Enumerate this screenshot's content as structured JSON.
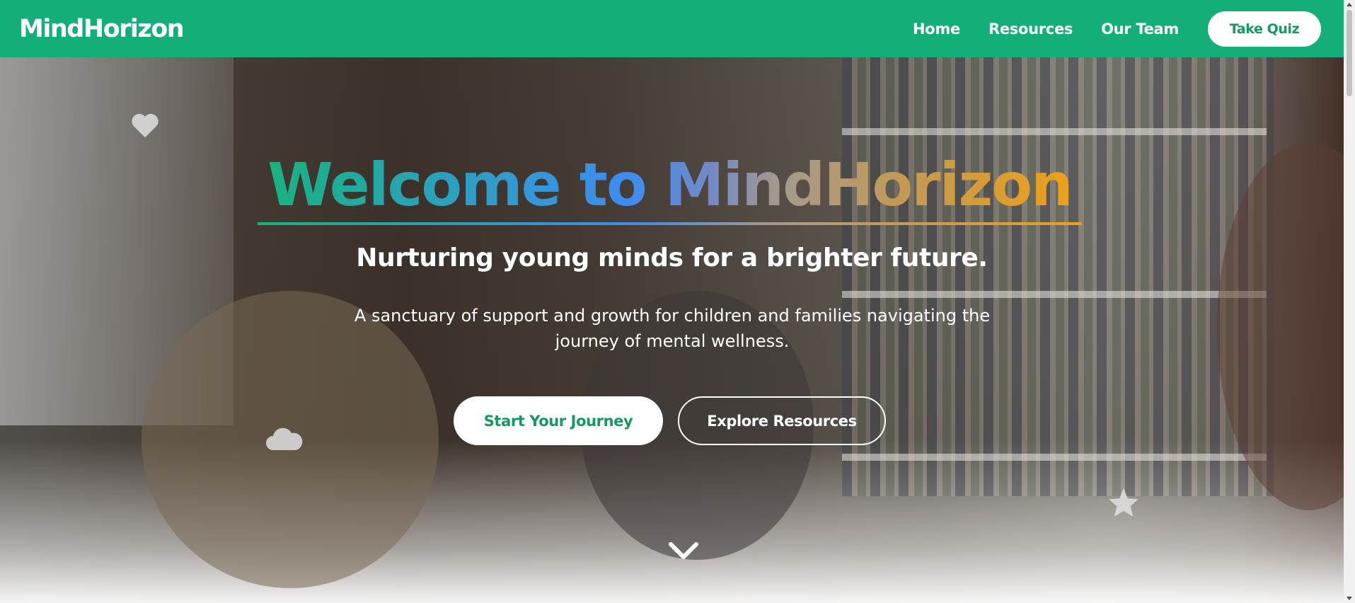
{
  "nav": {
    "logo": "MindHorizon",
    "links": [
      "Home",
      "Resources",
      "Our Team"
    ],
    "cta": "Take Quiz"
  },
  "hero": {
    "title": "Welcome to MindHorizon",
    "subtitle": "Nurturing young minds for a brighter future.",
    "description": "A sanctuary of support and growth for children and families navigating the journey of mental wellness.",
    "primary_button": "Start Your Journey",
    "secondary_button": "Explore Resources",
    "decor_icons": [
      "heart-icon",
      "cloud-icon",
      "star-icon"
    ],
    "scroll_icon": "chevron-down-icon"
  },
  "colors": {
    "brand": "#14ae78",
    "button_text": "#14995f",
    "title_gradient": [
      "#16b47c",
      "#3d8cf0",
      "#a39a8f",
      "#f0a014"
    ]
  }
}
